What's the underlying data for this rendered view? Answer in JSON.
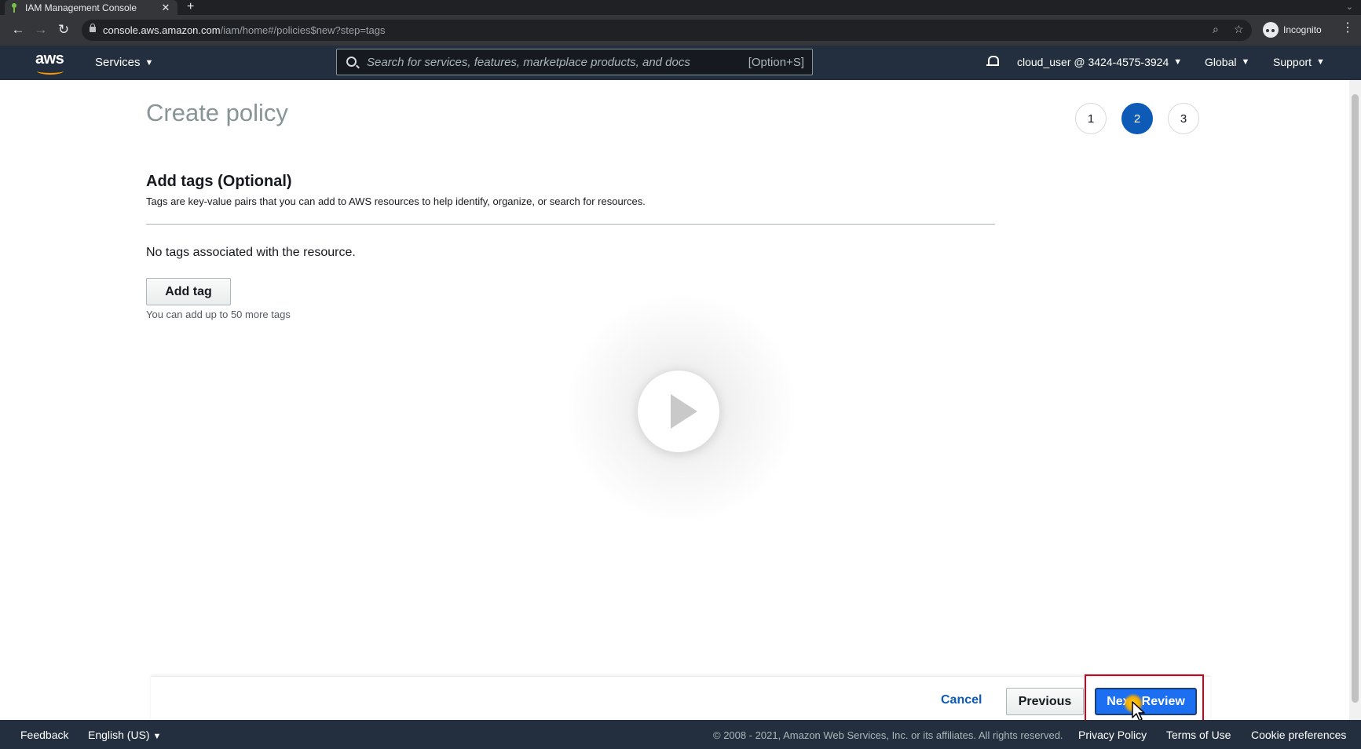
{
  "browser": {
    "tab_title": "IAM Management Console",
    "tab_close": "✕",
    "new_tab": "+",
    "tab_menu": "⌄",
    "url_host": "console.aws.amazon.com",
    "url_path": "/iam/home#/policies$new?step=tags",
    "profile_label": "Incognito",
    "menu_glyph": "⋮"
  },
  "aws_nav": {
    "logo_text": "aws",
    "services_label": "Services",
    "search_placeholder": "Search for services, features, marketplace products, and docs",
    "search_shortcut": "[Option+S]",
    "account_label": "cloud_user @ 3424-4575-3924",
    "region_label": "Global",
    "support_label": "Support",
    "caret": "▼"
  },
  "page": {
    "title": "Create policy",
    "steps": [
      {
        "label": "1",
        "active": false
      },
      {
        "label": "2",
        "active": true
      },
      {
        "label": "3",
        "active": false
      }
    ],
    "section_title": "Add tags (Optional)",
    "section_description": "Tags are key-value pairs that you can add to AWS resources to help identify, organize, or search for resources.",
    "empty_message": "No tags associated with the resource.",
    "add_tag_label": "Add tag",
    "tag_limit_text": "You can add up to 50 more tags"
  },
  "actions": {
    "cancel_label": "Cancel",
    "previous_label": "Previous",
    "next_label": "Next: Review"
  },
  "footer": {
    "feedback_label": "Feedback",
    "language_label": "English (US)",
    "copyright": "© 2008 - 2021, Amazon Web Services, Inc. or its affiliates. All rights reserved.",
    "privacy_label": "Privacy Policy",
    "terms_label": "Terms of Use",
    "cookie_label": "Cookie preferences"
  },
  "colors": {
    "nav_bg": "#232f3e",
    "accent_orange": "#ff9900",
    "primary_blue": "#1b6ff0",
    "link_blue": "#0d5ab7",
    "highlight_red": "#d0021b"
  }
}
